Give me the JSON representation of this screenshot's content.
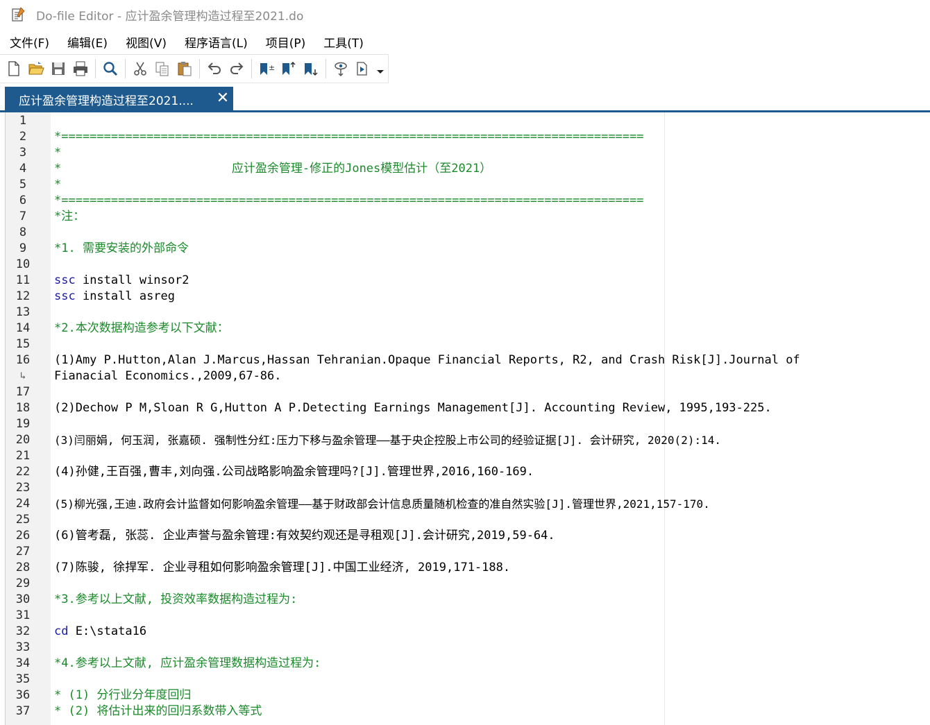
{
  "window": {
    "app_name": "Do-file Editor - 应计盈余管理构造过程至2021.do"
  },
  "menu": [
    {
      "label": "文件(F)"
    },
    {
      "label": "编辑(E)"
    },
    {
      "label": "视图(V)"
    },
    {
      "label": "程序语言(L)"
    },
    {
      "label": "项目(P)"
    },
    {
      "label": "工具(T)"
    }
  ],
  "toolbar": {
    "icons": [
      "new-file-icon",
      "open-folder-icon",
      "save-icon",
      "print-icon",
      "find-icon",
      "cut-icon",
      "copy-icon",
      "paste-icon",
      "undo-icon",
      "redo-icon",
      "bookmark-toggle-icon",
      "bookmark-prev-icon",
      "bookmark-next-icon",
      "show-file-icon",
      "execute-icon"
    ]
  },
  "tab": {
    "label": "应计盈余管理构造过程至2021....",
    "close_symbol": "✕"
  },
  "colors": {
    "accent": "#1f5a8e",
    "comment": "#1a8a2a",
    "keyword": "#1a1aa6"
  },
  "gutter": {
    "line_numbers": [
      "1",
      "2",
      "3",
      "4",
      "5",
      "6",
      "7",
      "8",
      "9",
      "10",
      "11",
      "12",
      "13",
      "14",
      "15",
      "16",
      "↳",
      "17",
      "18",
      "19",
      "20",
      "21",
      "22",
      "23",
      "24",
      "25",
      "26",
      "27",
      "28",
      "29",
      "30",
      "31",
      "32",
      "33",
      "34",
      "35",
      "36",
      "37"
    ]
  },
  "code": {
    "l2": "*==================================================================================",
    "l3": "*",
    "l4": "*                        应计盈余管理-修正的Jones模型估计（至2021）",
    "l5": "*",
    "l6": "*==================================================================================",
    "l7": "*注：",
    "l9": "*1. 需要安装的外部命令",
    "l11_kw": "ssc",
    "l11_rest": " install winsor2",
    "l12_kw": "ssc",
    "l12_rest": " install asreg",
    "l14": "*2.本次数据构造参考以下文献：",
    "l16": "(1)Amy P.Hutton,Alan J.Marcus,Hassan Tehranian.Opaque Financial Reports, R2, and Crash Risk[J].Journal of",
    "l16b": "Fianacial Economics.,2009,67-86.",
    "l18": "(2)Dechow P M,Sloan R G,Hutton A P.Detecting Earnings Management[J]. Accounting Review, 1995,193-225.",
    "l20": "(3)闫丽娟, 何玉润, 张嘉硕. 强制性分红:压力下移与盈余管理——基于央企控股上市公司的经验证据[J]. 会计研究, 2020(2):14.",
    "l22": "(4)孙健,王百强,曹丰,刘向强.公司战略影响盈余管理吗?[J].管理世界,2016,160-169.",
    "l24": "(5)柳光强,王迪.政府会计监督如何影响盈余管理——基于财政部会计信息质量随机检查的准自然实验[J].管理世界,2021,157-170.",
    "l26": "(6)管考磊, 张蕊. 企业声誉与盈余管理:有效契约观还是寻租观[J].会计研究,2019,59-64.",
    "l28": "(7)陈骏, 徐捍军. 企业寻租如何影响盈余管理[J].中国工业经济, 2019,171-188.",
    "l30": "*3.参考以上文献, 投资效率数据构造过程为:",
    "l32_kw": "cd",
    "l32_rest": " E:\\stata16",
    "l34": "*4.参考以上文献, 应计盈余管理数据构造过程为:",
    "l36": "* (1) 分行业分年度回归",
    "l37": "* (2) 将估计出来的回归系数带入等式"
  }
}
